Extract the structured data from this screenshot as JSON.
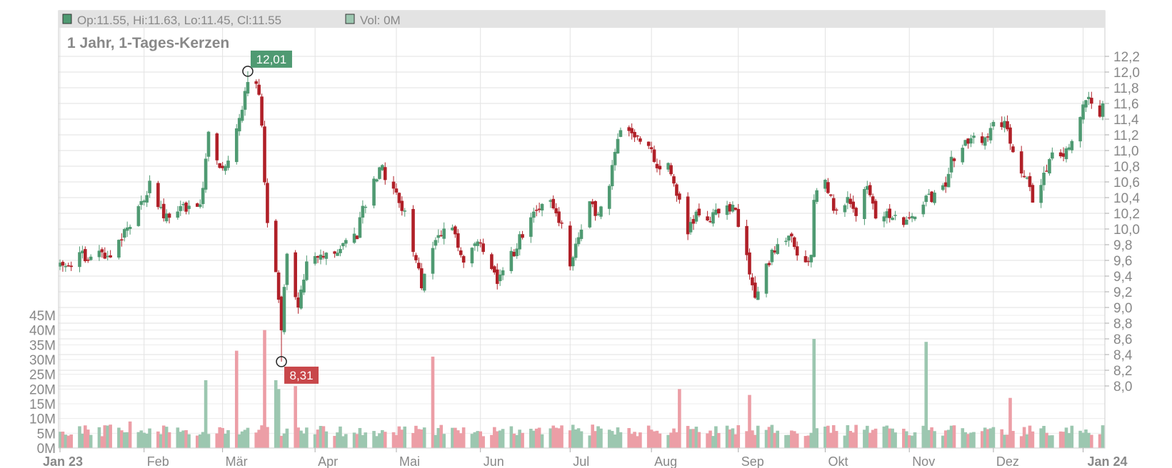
{
  "legend": {
    "ohlc": "Op:11.55, Hi:11.63, Lo:11.45, Cl:11.55",
    "volume": "Vol: 0M",
    "ohlc_color": "#4f9a72",
    "volume_color": "#9cc7b0"
  },
  "title": "1 Jahr, 1-Tages-Kerzen",
  "colors": {
    "up": "#4f9a72",
    "down": "#b02028",
    "vol_up": "#9cc7b0",
    "vol_down": "#ec9ea6",
    "high_label_bg": "#4f9a72",
    "low_label_bg": "#c8474a"
  },
  "callouts": {
    "high_label": "12,01",
    "low_label": "8,31"
  },
  "chart_data": {
    "type": "candlestick",
    "title": "1 Jahr, 1-Tages-Kerzen",
    "price_axis": {
      "side": "right",
      "range": [
        7.9,
        12.3
      ],
      "ticks": [
        "12,2",
        "12,0",
        "11,8",
        "11,6",
        "11,4",
        "11,2",
        "11,0",
        "10,8",
        "10,6",
        "10,4",
        "10,2",
        "10,0",
        "9,8",
        "9,6",
        "9,4",
        "9,2",
        "9,0",
        "8,8",
        "8,6",
        "8,4",
        "8,2",
        "8,0"
      ],
      "tick_values": [
        12.2,
        12.0,
        11.8,
        11.6,
        11.4,
        11.2,
        11.0,
        10.8,
        10.6,
        10.4,
        10.2,
        10.0,
        9.8,
        9.6,
        9.4,
        9.2,
        9.0,
        8.8,
        8.6,
        8.4,
        8.2,
        8.0
      ]
    },
    "volume_axis": {
      "side": "left",
      "unit": "M",
      "range": [
        0,
        45
      ],
      "ticks": [
        "45M",
        "40M",
        "35M",
        "30M",
        "25M",
        "20M",
        "15M",
        "10M",
        "5M",
        "0M"
      ],
      "tick_values": [
        45,
        40,
        35,
        30,
        25,
        20,
        15,
        10,
        5,
        0
      ]
    },
    "x_axis": {
      "start": "2023-01-02",
      "end": "2024-01-09",
      "ticks": [
        {
          "label": "Jan 23",
          "date": "2023-01-02",
          "bold": true
        },
        {
          "label": "Feb",
          "date": "2023-02-01",
          "bold": false
        },
        {
          "label": "Mär",
          "date": "2023-03-01",
          "bold": false
        },
        {
          "label": "Apr",
          "date": "2023-04-03",
          "bold": false
        },
        {
          "label": "Mai",
          "date": "2023-05-02",
          "bold": false
        },
        {
          "label": "Jun",
          "date": "2023-06-01",
          "bold": false
        },
        {
          "label": "Jul",
          "date": "2023-07-03",
          "bold": false
        },
        {
          "label": "Aug",
          "date": "2023-08-01",
          "bold": false
        },
        {
          "label": "Sep",
          "date": "2023-09-01",
          "bold": false
        },
        {
          "label": "Okt",
          "date": "2023-10-02",
          "bold": false
        },
        {
          "label": "Nov",
          "date": "2023-11-01",
          "bold": false
        },
        {
          "label": "Dez",
          "date": "2023-12-01",
          "bold": false
        },
        {
          "label": "Jan 24",
          "date": "2024-01-02",
          "bold": true
        }
      ]
    },
    "close_path": [
      [
        "2023-01-02",
        9.5
      ],
      [
        "2023-01-10",
        9.65
      ],
      [
        "2023-01-20",
        9.7
      ],
      [
        "2023-01-27",
        10.05
      ],
      [
        "2023-02-03",
        10.55
      ],
      [
        "2023-02-08",
        10.15
      ],
      [
        "2023-02-15",
        10.3
      ],
      [
        "2023-02-21",
        10.25
      ],
      [
        "2023-02-24",
        11.2
      ],
      [
        "2023-03-01",
        10.7
      ],
      [
        "2023-03-03",
        10.95
      ],
      [
        "2023-03-06",
        11.3
      ],
      [
        "2023-03-09",
        11.7
      ],
      [
        "2023-03-10",
        11.95
      ],
      [
        "2023-03-14",
        11.75
      ],
      [
        "2023-03-15",
        11.3
      ],
      [
        "2023-03-17",
        10.0
      ],
      [
        "2023-03-20",
        9.5
      ],
      [
        "2023-03-22",
        8.7
      ],
      [
        "2023-03-24",
        9.7
      ],
      [
        "2023-03-28",
        9.0
      ],
      [
        "2023-03-31",
        9.55
      ],
      [
        "2023-04-05",
        9.65
      ],
      [
        "2023-04-11",
        9.75
      ],
      [
        "2023-04-18",
        9.95
      ],
      [
        "2023-04-21",
        10.35
      ],
      [
        "2023-04-26",
        10.8
      ],
      [
        "2023-05-02",
        10.45
      ],
      [
        "2023-05-05",
        10.2
      ],
      [
        "2023-05-09",
        9.65
      ],
      [
        "2023-05-11",
        9.3
      ],
      [
        "2023-05-16",
        9.9
      ],
      [
        "2023-05-22",
        10.0
      ],
      [
        "2023-05-26",
        9.5
      ],
      [
        "2023-05-30",
        9.85
      ],
      [
        "2023-06-02",
        9.7
      ],
      [
        "2023-06-07",
        9.35
      ],
      [
        "2023-06-12",
        9.65
      ],
      [
        "2023-06-16",
        9.95
      ],
      [
        "2023-06-21",
        10.2
      ],
      [
        "2023-06-26",
        10.3
      ],
      [
        "2023-06-29",
        10.15
      ],
      [
        "2023-07-03",
        9.6
      ],
      [
        "2023-07-06",
        9.9
      ],
      [
        "2023-07-10",
        10.3
      ],
      [
        "2023-07-13",
        10.15
      ],
      [
        "2023-07-17",
        10.55
      ],
      [
        "2023-07-19",
        10.95
      ],
      [
        "2023-07-21",
        11.25
      ],
      [
        "2023-07-26",
        11.2
      ],
      [
        "2023-07-31",
        11.05
      ],
      [
        "2023-08-03",
        10.75
      ],
      [
        "2023-08-07",
        10.9
      ],
      [
        "2023-08-10",
        10.4
      ],
      [
        "2023-08-14",
        10.0
      ],
      [
        "2023-08-17",
        10.2
      ],
      [
        "2023-08-21",
        10.15
      ],
      [
        "2023-08-24",
        10.2
      ],
      [
        "2023-08-28",
        10.35
      ],
      [
        "2023-08-31",
        10.2
      ],
      [
        "2023-09-04",
        9.6
      ],
      [
        "2023-09-07",
        9.2
      ],
      [
        "2023-09-11",
        9.5
      ],
      [
        "2023-09-14",
        9.75
      ],
      [
        "2023-09-19",
        9.95
      ],
      [
        "2023-09-22",
        9.6
      ],
      [
        "2023-09-27",
        9.65
      ],
      [
        "2023-09-28",
        10.45
      ],
      [
        "2023-10-02",
        10.6
      ],
      [
        "2023-10-05",
        10.25
      ],
      [
        "2023-10-10",
        10.4
      ],
      [
        "2023-10-13",
        10.1
      ],
      [
        "2023-10-17",
        10.6
      ],
      [
        "2023-10-20",
        10.2
      ],
      [
        "2023-10-25",
        10.2
      ],
      [
        "2023-10-30",
        10.1
      ],
      [
        "2023-11-03",
        10.2
      ],
      [
        "2023-11-08",
        10.4
      ],
      [
        "2023-11-13",
        10.5
      ],
      [
        "2023-11-16",
        10.85
      ],
      [
        "2023-11-21",
        11.1
      ],
      [
        "2023-11-24",
        11.25
      ],
      [
        "2023-11-28",
        11.1
      ],
      [
        "2023-12-01",
        11.3
      ],
      [
        "2023-12-05",
        11.4
      ],
      [
        "2023-12-08",
        10.9
      ],
      [
        "2023-12-12",
        10.7
      ],
      [
        "2023-12-15",
        10.4
      ],
      [
        "2023-12-19",
        10.7
      ],
      [
        "2023-12-22",
        10.9
      ],
      [
        "2023-12-28",
        11.05
      ],
      [
        "2024-01-02",
        11.55
      ],
      [
        "2024-01-04",
        11.7
      ],
      [
        "2024-01-08",
        11.45
      ],
      [
        "2024-01-09",
        11.55
      ]
    ],
    "volume_spikes": [
      {
        "date": "2023-01-27",
        "value": 9,
        "dir": "down"
      },
      {
        "date": "2023-02-23",
        "value": 23,
        "dir": "up"
      },
      {
        "date": "2023-03-06",
        "value": 33,
        "dir": "down"
      },
      {
        "date": "2023-03-16",
        "value": 40,
        "dir": "down"
      },
      {
        "date": "2023-03-20",
        "value": 23,
        "dir": "up"
      },
      {
        "date": "2023-03-21",
        "value": 20,
        "dir": "up"
      },
      {
        "date": "2023-03-27",
        "value": 21,
        "dir": "down"
      },
      {
        "date": "2023-05-15",
        "value": 31,
        "dir": "down"
      },
      {
        "date": "2023-08-11",
        "value": 20,
        "dir": "down"
      },
      {
        "date": "2023-09-05",
        "value": 18,
        "dir": "down"
      },
      {
        "date": "2023-09-28",
        "value": 37,
        "dir": "up"
      },
      {
        "date": "2023-11-07",
        "value": 36,
        "dir": "up"
      },
      {
        "date": "2023-12-07",
        "value": 17,
        "dir": "down"
      }
    ],
    "high": {
      "date": "2023-03-10",
      "value": 12.01
    },
    "low": {
      "date": "2023-03-22",
      "value": 8.31
    },
    "grid": true,
    "legend_placement": "top"
  }
}
